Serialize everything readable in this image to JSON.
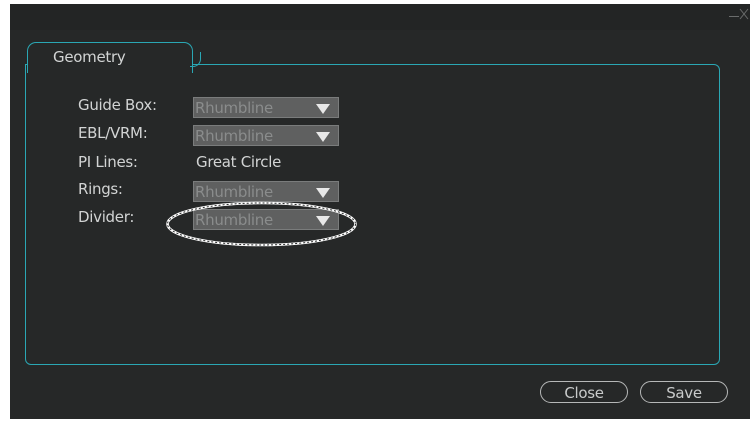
{
  "window": {
    "minimize_icon": "minimize-icon",
    "close_icon": "close-icon"
  },
  "tab": {
    "label": "Geometry"
  },
  "rows": [
    {
      "label": "Guide Box:",
      "value": "Rhumbline",
      "type": "select"
    },
    {
      "label": "EBL/VRM:",
      "value": "Rhumbline",
      "type": "select"
    },
    {
      "label": "PI Lines:",
      "value": "Great Circle",
      "type": "static"
    },
    {
      "label": "Rings:",
      "value": "Rhumbline",
      "type": "select"
    },
    {
      "label": "Divider:",
      "value": "Rhumbline",
      "type": "select"
    }
  ],
  "buttons": {
    "close": "Close",
    "save": "Save"
  },
  "colors": {
    "accent": "#2aa7b4",
    "dialog_bg": "#262828",
    "select_bg": "#5f6060",
    "text": "#d2d4d4"
  }
}
